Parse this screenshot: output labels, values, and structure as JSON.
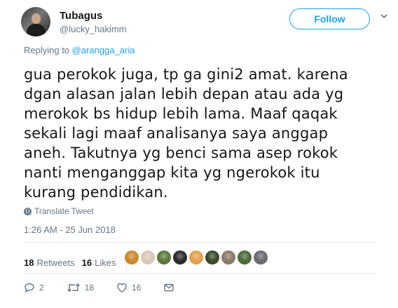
{
  "user": {
    "name": "Tubagus",
    "handle": "@lucky_hakimm"
  },
  "follow_label": "Follow",
  "replying": {
    "prefix": "Replying to",
    "to": "@arangga_aria"
  },
  "tweet_lines": [
    "gua perokok juga, tp ga gini2 amat. karena",
    "dgan alasan jalan lebih depan atau ada yg",
    "merokok bs hidup lebih lama. Maaf qaqak",
    "sekali lagi maaf analisanya saya anggap",
    "aneh. Takutnya yg benci sama asep rokok",
    "nanti menganggap kita yg ngerokok itu",
    "kurang pendidikan."
  ],
  "translate_label": "Translate Tweet",
  "timestamp": "1:26 AM - 25 Jun 2018",
  "stats": {
    "retweets_count": "18",
    "retweets_label": "Retweets",
    "likes_count": "16",
    "likes_label": "Likes"
  },
  "liker_colors": [
    "#c98a2e",
    "#d9c8b8",
    "#5a7a3c",
    "#2c2c2c",
    "#e0a14a",
    "#3a4a2a",
    "#8a7a6a",
    "#4a6a3a",
    "#6a6a70"
  ],
  "actions": {
    "reply_count": "2",
    "retweet_count": "18",
    "like_count": "16"
  },
  "colors": {
    "accent": "#1da1f2",
    "muted": "#657786",
    "text": "#14171a"
  }
}
